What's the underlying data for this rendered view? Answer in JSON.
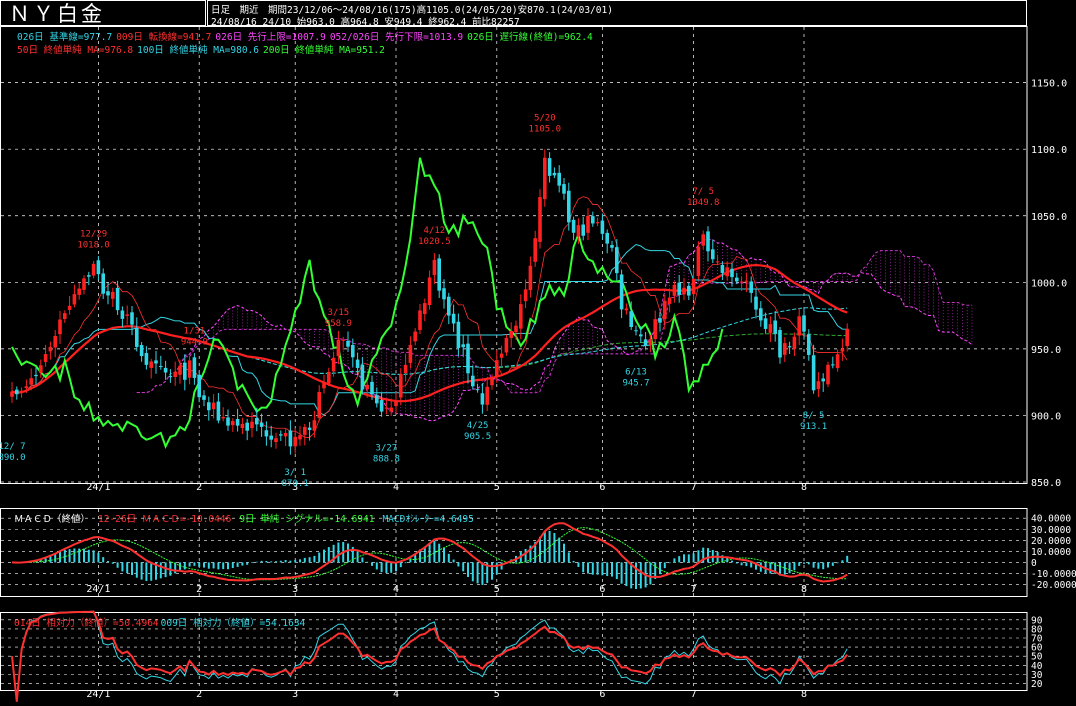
{
  "header": {
    "title": "ＮＹ白金",
    "info_line1": "日足　期近　期間23/12/06〜24/08/16(175)高1105.0(24/05/20)安870.1(24/03/01)",
    "info_line2": "24/08/16 24/10 始963.0 高964.8 安949.4 終962.4 前比82257"
  },
  "legend_main_1": [
    {
      "text": "026日 基準線=977.7",
      "color": "#33d6e6"
    },
    {
      "text": "009日 転換線=941.7",
      "color": "#ff3030"
    },
    {
      "text": "026日 先行上限=1007.9",
      "color": "#ff44ff"
    },
    {
      "text": "052/026日 先行下限=1013.9",
      "color": "#ff44ff"
    },
    {
      "text": "026日 遅行線(終値)=962.4",
      "color": "#33ff33"
    }
  ],
  "legend_main_2": [
    {
      "text": "50日 終値単純 MA=976.8",
      "color": "#ff3030"
    },
    {
      "text": "100日 終値単純 MA=980.6",
      "color": "#33d6e6"
    },
    {
      "text": "200日 終値単純 MA=951.2",
      "color": "#33ff33"
    }
  ],
  "legend_macd": [
    {
      "text": "ＭＡＣＤ（終値）",
      "color": "#ffffff"
    },
    {
      "text": "12-26日 ＭＡＣＤ=-10.0446",
      "color": "#ff3030"
    },
    {
      "text": "9日 単純 シグナル=-14.6941",
      "color": "#33ff33"
    },
    {
      "text": "MACDｵｼﾚｰﾀｰ=4.6495",
      "color": "#33d6e6"
    }
  ],
  "legend_rsi": [
    {
      "text": "014日 相対力（終値）=50.4964",
      "color": "#ff3030"
    },
    {
      "text": "009日 相対力（終値）=54.1634",
      "color": "#33d6e6"
    }
  ],
  "colors": {
    "up": "#ff2020",
    "down": "#33d6e6",
    "cloud_upper": "#ff44ff",
    "cloud_lower": "#cc33cc",
    "kijun": "#33d6e6",
    "tenkan": "#ff3030",
    "chikou": "#33ff33",
    "ma50": "#ff2020",
    "ma100": "#33d6e6",
    "ma200": "#33aa33",
    "grid": "#ffffff",
    "annotation_high": "#ff3030",
    "annotation_low": "#33d6e6"
  },
  "chart_data": [
    {
      "type": "candlestick",
      "panel": "price",
      "ylim": [
        850,
        1170
      ],
      "y_ticks": [
        "1150.0",
        "1100.0",
        "1050.0",
        "1000.0",
        "950.0",
        "900.0",
        "850.0"
      ],
      "x_ticks": [
        {
          "label": "24/1",
          "index": 18
        },
        {
          "label": "2",
          "index": 39
        },
        {
          "label": "3",
          "index": 59
        },
        {
          "label": "4",
          "index": 80
        },
        {
          "label": "5",
          "index": 101
        },
        {
          "label": "6",
          "index": 123
        },
        {
          "label": "7",
          "index": 142
        },
        {
          "label": "8",
          "index": 165
        }
      ],
      "bar_count": 175,
      "projection": 26,
      "anchors": [
        [
          0,
          925
        ],
        [
          2,
          915
        ],
        [
          5,
          930
        ],
        [
          7,
          945
        ],
        [
          11,
          980
        ],
        [
          14,
          1000
        ],
        [
          17,
          1012
        ],
        [
          19,
          995
        ],
        [
          22,
          985
        ],
        [
          26,
          955
        ],
        [
          29,
          935
        ],
        [
          33,
          928
        ],
        [
          37,
          935
        ],
        [
          39,
          915
        ],
        [
          41,
          905
        ],
        [
          44,
          898
        ],
        [
          48,
          893
        ],
        [
          52,
          890
        ],
        [
          55,
          888
        ],
        [
          59,
          878
        ],
        [
          62,
          895
        ],
        [
          65,
          920
        ],
        [
          68,
          955
        ],
        [
          70,
          945
        ],
        [
          73,
          925
        ],
        [
          76,
          910
        ],
        [
          79,
          900
        ],
        [
          81,
          935
        ],
        [
          84,
          960
        ],
        [
          86,
          990
        ],
        [
          88,
          1015
        ],
        [
          90,
          985
        ],
        [
          93,
          955
        ],
        [
          96,
          925
        ],
        [
          98,
          912
        ],
        [
          101,
          935
        ],
        [
          104,
          965
        ],
        [
          107,
          990
        ],
        [
          109,
          1040
        ],
        [
          111,
          1090
        ],
        [
          113,
          1075
        ],
        [
          115,
          1060
        ],
        [
          117,
          1035
        ],
        [
          120,
          1045
        ],
        [
          123,
          1040
        ],
        [
          125,
          1025
        ],
        [
          127,
          985
        ],
        [
          130,
          965
        ],
        [
          132,
          955
        ],
        [
          135,
          975
        ],
        [
          137,
          995
        ],
        [
          139,
          990
        ],
        [
          142,
          1000
        ],
        [
          144,
          1040
        ],
        [
          146,
          1020
        ],
        [
          148,
          1008
        ],
        [
          150,
          1005
        ],
        [
          152,
          1000
        ],
        [
          154,
          990
        ],
        [
          156,
          975
        ],
        [
          158,
          965
        ],
        [
          160,
          950
        ],
        [
          162,
          958
        ],
        [
          164,
          972
        ],
        [
          166,
          940
        ],
        [
          167,
          920
        ],
        [
          169,
          930
        ],
        [
          171,
          945
        ],
        [
          173,
          955
        ],
        [
          174,
          962
        ]
      ],
      "annotations": [
        {
          "date": "12/29",
          "value": "1018.0",
          "index": 17,
          "kind": "high"
        },
        {
          "date": "4/12",
          "value": "1020.5",
          "index": 88,
          "kind": "high"
        },
        {
          "date": "3/15",
          "value": "958.9",
          "index": 68,
          "kind": "high"
        },
        {
          "date": "5/20",
          "value": "1105.0",
          "index": 111,
          "kind": "high"
        },
        {
          "date": "7/ 5",
          "value": "1049.8",
          "index": 144,
          "kind": "high"
        },
        {
          "date": "1/31",
          "value": "944.9",
          "index": 38,
          "kind": "high"
        },
        {
          "date": "12/ 7",
          "value": "890.0",
          "index": 0,
          "kind": "low"
        },
        {
          "date": "3/ 1",
          "value": "870.1",
          "index": 59,
          "kind": "low"
        },
        {
          "date": "3/27",
          "value": "888.8",
          "index": 78,
          "kind": "low"
        },
        {
          "date": "4/25",
          "value": "905.5",
          "index": 97,
          "kind": "low"
        },
        {
          "date": "6/13",
          "value": "945.7",
          "index": 130,
          "kind": "low"
        },
        {
          "date": "8/ 5",
          "value": "913.1",
          "index": 167,
          "kind": "low"
        }
      ],
      "series": [
        "基準線",
        "転換線",
        "先行上限",
        "先行下限",
        "遅行線",
        "50日MA",
        "100日MA",
        "200日MA"
      ]
    },
    {
      "type": "line",
      "panel": "macd",
      "ylim": [
        -25,
        42
      ],
      "y_ticks": [
        "40.0000",
        "30.0000",
        "20.0000",
        "10.0000",
        "0",
        "-10.0000",
        "-20.0000"
      ],
      "series": [
        "MACD",
        "シグナル",
        "MACDオシレーター"
      ]
    },
    {
      "type": "line",
      "panel": "rsi",
      "ylim": [
        15,
        92
      ],
      "y_ticks": [
        "90",
        "80",
        "70",
        "60",
        "50",
        "40",
        "30",
        "20"
      ],
      "series": [
        "14日相対力",
        "9日相対力"
      ]
    }
  ]
}
